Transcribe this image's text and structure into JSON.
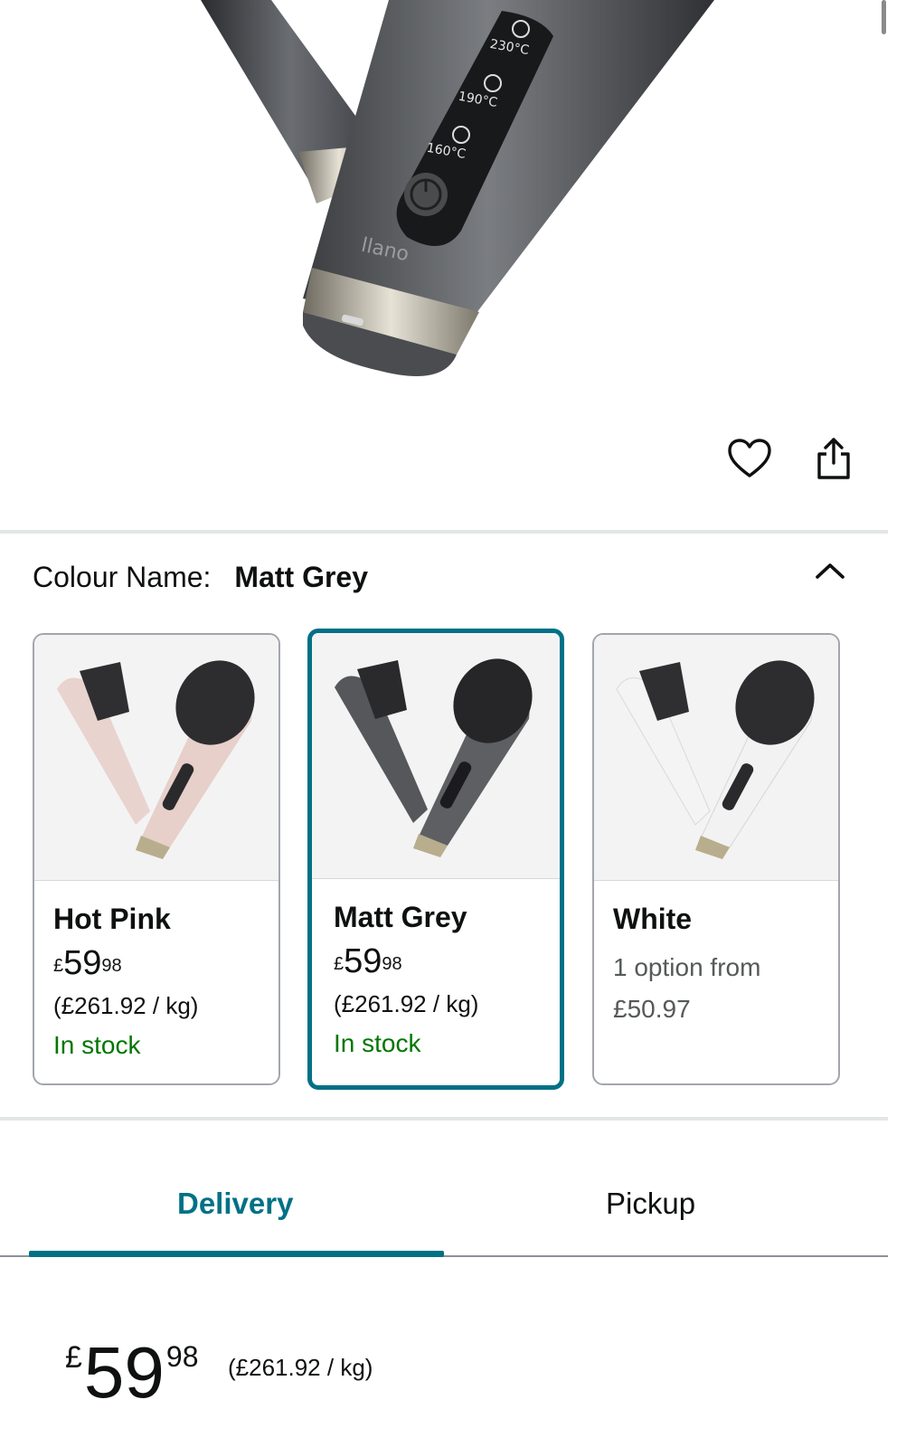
{
  "product": {
    "brand_marking": "llano",
    "temp_settings": [
      "230°C",
      "190°C",
      "160°C"
    ]
  },
  "actions": {
    "favourite_icon": "heart-icon",
    "share_icon": "share-icon"
  },
  "colour_selector": {
    "label": "Colour Name:",
    "selected": "Matt Grey",
    "options": [
      {
        "name": "Hot Pink",
        "currency": "£",
        "price_whole": "59",
        "price_fraction": "98",
        "unit_price": "(£261.92 / kg)",
        "availability": "In stock",
        "body_color": "#e9d3cf"
      },
      {
        "name": "Matt Grey",
        "currency": "£",
        "price_whole": "59",
        "price_fraction": "98",
        "unit_price": "(£261.92 / kg)",
        "availability": "In stock",
        "body_color": "#55575a"
      },
      {
        "name": "White",
        "option_line1": "1 option from",
        "option_line2": "£50.97",
        "body_color": "#f1f1f1"
      }
    ]
  },
  "tabs": {
    "delivery": "Delivery",
    "pickup": "Pickup",
    "active": "Delivery"
  },
  "price_block": {
    "currency": "£",
    "whole": "59",
    "fraction": "98",
    "unit_price": "(£261.92 / kg)"
  },
  "colors": {
    "accent_teal": "#007185",
    "in_stock_green": "#007600",
    "divider": "#e3e6e6"
  }
}
